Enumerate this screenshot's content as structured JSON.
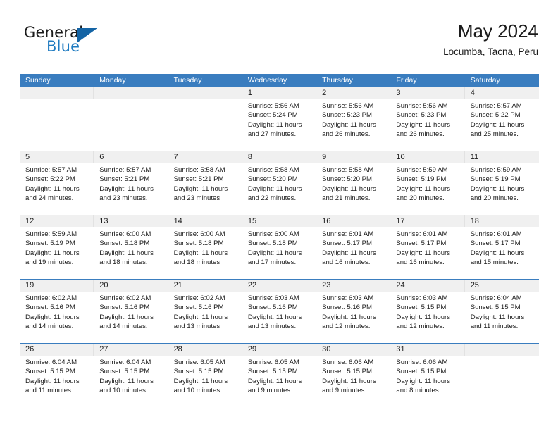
{
  "brand": {
    "name_top": "General",
    "name_bottom": "Blue",
    "triangle_color": "#1464a5",
    "blue_color": "#1f7bc1"
  },
  "header": {
    "title": "May 2024",
    "subtitle": "Locumba, Tacna, Peru"
  },
  "theme": {
    "header_blue": "#3a7dbf",
    "day_band_gray": "#f0f0f0",
    "text": "#1b1b1b"
  },
  "weekdays": [
    "Sunday",
    "Monday",
    "Tuesday",
    "Wednesday",
    "Thursday",
    "Friday",
    "Saturday"
  ],
  "weeks": [
    [
      {
        "day": "",
        "lines": []
      },
      {
        "day": "",
        "lines": []
      },
      {
        "day": "",
        "lines": []
      },
      {
        "day": "1",
        "lines": [
          "Sunrise: 5:56 AM",
          "Sunset: 5:24 PM",
          "Daylight: 11 hours",
          "and 27 minutes."
        ]
      },
      {
        "day": "2",
        "lines": [
          "Sunrise: 5:56 AM",
          "Sunset: 5:23 PM",
          "Daylight: 11 hours",
          "and 26 minutes."
        ]
      },
      {
        "day": "3",
        "lines": [
          "Sunrise: 5:56 AM",
          "Sunset: 5:23 PM",
          "Daylight: 11 hours",
          "and 26 minutes."
        ]
      },
      {
        "day": "4",
        "lines": [
          "Sunrise: 5:57 AM",
          "Sunset: 5:22 PM",
          "Daylight: 11 hours",
          "and 25 minutes."
        ]
      }
    ],
    [
      {
        "day": "5",
        "lines": [
          "Sunrise: 5:57 AM",
          "Sunset: 5:22 PM",
          "Daylight: 11 hours",
          "and 24 minutes."
        ]
      },
      {
        "day": "6",
        "lines": [
          "Sunrise: 5:57 AM",
          "Sunset: 5:21 PM",
          "Daylight: 11 hours",
          "and 23 minutes."
        ]
      },
      {
        "day": "7",
        "lines": [
          "Sunrise: 5:58 AM",
          "Sunset: 5:21 PM",
          "Daylight: 11 hours",
          "and 23 minutes."
        ]
      },
      {
        "day": "8",
        "lines": [
          "Sunrise: 5:58 AM",
          "Sunset: 5:20 PM",
          "Daylight: 11 hours",
          "and 22 minutes."
        ]
      },
      {
        "day": "9",
        "lines": [
          "Sunrise: 5:58 AM",
          "Sunset: 5:20 PM",
          "Daylight: 11 hours",
          "and 21 minutes."
        ]
      },
      {
        "day": "10",
        "lines": [
          "Sunrise: 5:59 AM",
          "Sunset: 5:19 PM",
          "Daylight: 11 hours",
          "and 20 minutes."
        ]
      },
      {
        "day": "11",
        "lines": [
          "Sunrise: 5:59 AM",
          "Sunset: 5:19 PM",
          "Daylight: 11 hours",
          "and 20 minutes."
        ]
      }
    ],
    [
      {
        "day": "12",
        "lines": [
          "Sunrise: 5:59 AM",
          "Sunset: 5:19 PM",
          "Daylight: 11 hours",
          "and 19 minutes."
        ]
      },
      {
        "day": "13",
        "lines": [
          "Sunrise: 6:00 AM",
          "Sunset: 5:18 PM",
          "Daylight: 11 hours",
          "and 18 minutes."
        ]
      },
      {
        "day": "14",
        "lines": [
          "Sunrise: 6:00 AM",
          "Sunset: 5:18 PM",
          "Daylight: 11 hours",
          "and 18 minutes."
        ]
      },
      {
        "day": "15",
        "lines": [
          "Sunrise: 6:00 AM",
          "Sunset: 5:18 PM",
          "Daylight: 11 hours",
          "and 17 minutes."
        ]
      },
      {
        "day": "16",
        "lines": [
          "Sunrise: 6:01 AM",
          "Sunset: 5:17 PM",
          "Daylight: 11 hours",
          "and 16 minutes."
        ]
      },
      {
        "day": "17",
        "lines": [
          "Sunrise: 6:01 AM",
          "Sunset: 5:17 PM",
          "Daylight: 11 hours",
          "and 16 minutes."
        ]
      },
      {
        "day": "18",
        "lines": [
          "Sunrise: 6:01 AM",
          "Sunset: 5:17 PM",
          "Daylight: 11 hours",
          "and 15 minutes."
        ]
      }
    ],
    [
      {
        "day": "19",
        "lines": [
          "Sunrise: 6:02 AM",
          "Sunset: 5:16 PM",
          "Daylight: 11 hours",
          "and 14 minutes."
        ]
      },
      {
        "day": "20",
        "lines": [
          "Sunrise: 6:02 AM",
          "Sunset: 5:16 PM",
          "Daylight: 11 hours",
          "and 14 minutes."
        ]
      },
      {
        "day": "21",
        "lines": [
          "Sunrise: 6:02 AM",
          "Sunset: 5:16 PM",
          "Daylight: 11 hours",
          "and 13 minutes."
        ]
      },
      {
        "day": "22",
        "lines": [
          "Sunrise: 6:03 AM",
          "Sunset: 5:16 PM",
          "Daylight: 11 hours",
          "and 13 minutes."
        ]
      },
      {
        "day": "23",
        "lines": [
          "Sunrise: 6:03 AM",
          "Sunset: 5:16 PM",
          "Daylight: 11 hours",
          "and 12 minutes."
        ]
      },
      {
        "day": "24",
        "lines": [
          "Sunrise: 6:03 AM",
          "Sunset: 5:15 PM",
          "Daylight: 11 hours",
          "and 12 minutes."
        ]
      },
      {
        "day": "25",
        "lines": [
          "Sunrise: 6:04 AM",
          "Sunset: 5:15 PM",
          "Daylight: 11 hours",
          "and 11 minutes."
        ]
      }
    ],
    [
      {
        "day": "26",
        "lines": [
          "Sunrise: 6:04 AM",
          "Sunset: 5:15 PM",
          "Daylight: 11 hours",
          "and 11 minutes."
        ]
      },
      {
        "day": "27",
        "lines": [
          "Sunrise: 6:04 AM",
          "Sunset: 5:15 PM",
          "Daylight: 11 hours",
          "and 10 minutes."
        ]
      },
      {
        "day": "28",
        "lines": [
          "Sunrise: 6:05 AM",
          "Sunset: 5:15 PM",
          "Daylight: 11 hours",
          "and 10 minutes."
        ]
      },
      {
        "day": "29",
        "lines": [
          "Sunrise: 6:05 AM",
          "Sunset: 5:15 PM",
          "Daylight: 11 hours",
          "and 9 minutes."
        ]
      },
      {
        "day": "30",
        "lines": [
          "Sunrise: 6:06 AM",
          "Sunset: 5:15 PM",
          "Daylight: 11 hours",
          "and 9 minutes."
        ]
      },
      {
        "day": "31",
        "lines": [
          "Sunrise: 6:06 AM",
          "Sunset: 5:15 PM",
          "Daylight: 11 hours",
          "and 8 minutes."
        ]
      },
      {
        "day": "",
        "lines": []
      }
    ]
  ]
}
